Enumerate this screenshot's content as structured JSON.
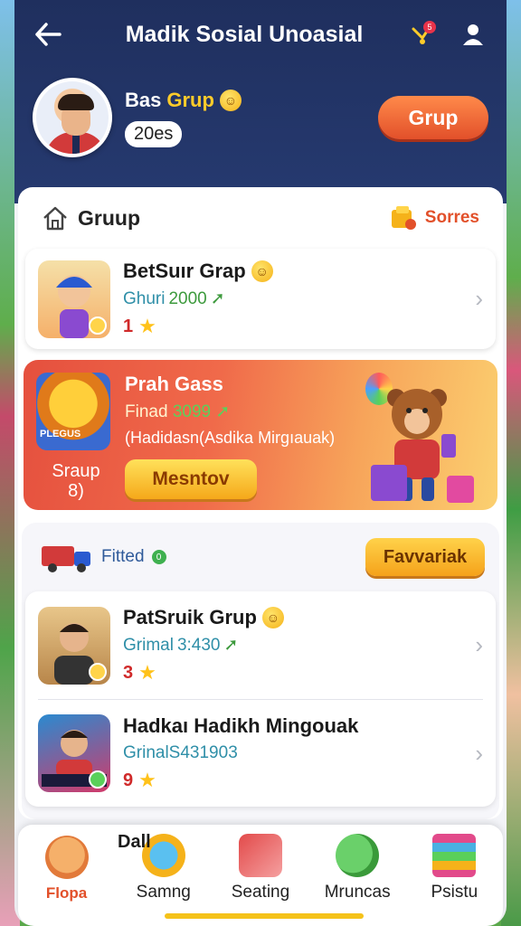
{
  "app": {
    "title": "Madik Sosial Unoasial"
  },
  "header": {
    "notif_count": "5",
    "profile": {
      "name_prefix": "Bas",
      "name_accent": "Grup",
      "age": "20es"
    },
    "grup_button": "Grup"
  },
  "section": {
    "title": "Gruup",
    "action": "Sorres"
  },
  "group_item": {
    "title": "BetSuır Grap",
    "sub_label": "Ghuri",
    "sub_value": "2000",
    "rating": "1"
  },
  "promo": {
    "title": "Prah Gass",
    "sub_label": "Finad",
    "sub_value": "3099",
    "desc": "(Hadidasn(Asdika Mirgıauak)",
    "side": "Sraup 8)",
    "button": "Mesntov",
    "thumb_text": "PLEGUS"
  },
  "fitted": {
    "label": "Fitted",
    "count": "0",
    "button": "Favvariak"
  },
  "list": [
    {
      "title": "PatSruik Grup",
      "sub_label": "Grimal",
      "sub_value": "3:430",
      "rating": "3"
    },
    {
      "title": "Hadkaı Hadikh Mingouak",
      "sub_label": "GrinalS431903",
      "sub_value": "",
      "rating": "9"
    }
  ],
  "peek_text": "Dall",
  "nav": [
    {
      "label": "Flopa",
      "icon": "face-leaf-icon",
      "active": true
    },
    {
      "label": "Samng",
      "icon": "gear-globe-icon"
    },
    {
      "label": "Seating",
      "icon": "pencil-book-icon"
    },
    {
      "label": "Mruncas",
      "icon": "chat-bubble-icon"
    },
    {
      "label": "Psistu",
      "icon": "books-stack-icon"
    }
  ],
  "colors": {
    "header_bg": "#1f2f5e",
    "accent_orange": "#e2502a",
    "accent_yellow": "#ffcc2a"
  }
}
